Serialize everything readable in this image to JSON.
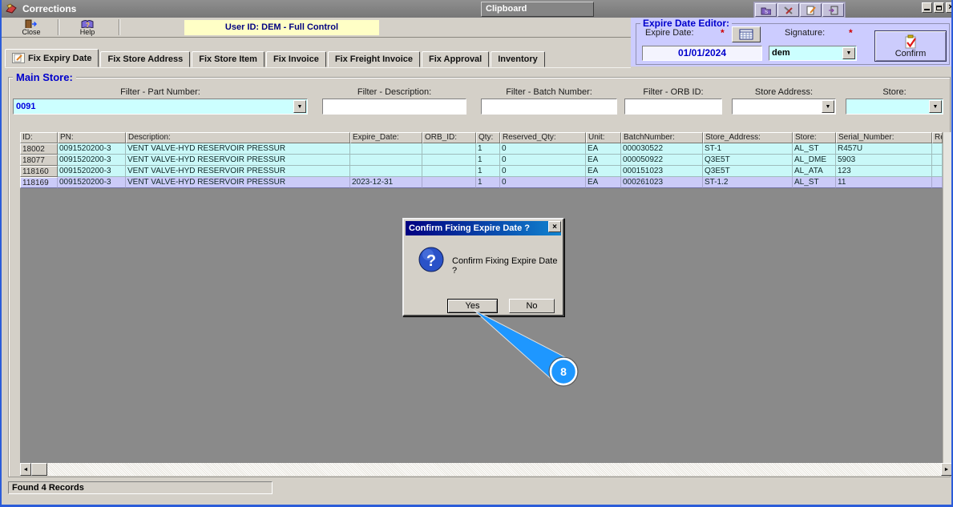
{
  "window": {
    "title": "Corrections",
    "secondary_title": "Clipboard"
  },
  "toolbar": {
    "close_label": "Close",
    "help_label": "Help",
    "user_banner": "User ID: DEM - Full Control"
  },
  "expire_editor": {
    "title": "Expire Date Editor:",
    "date_label": "Expire Date:",
    "required_marker": "*",
    "date_value": "01/01/2024",
    "signature_label": "Signature:",
    "signature_value": "dem",
    "confirm_label": "Confirm"
  },
  "tabs": [
    {
      "label": "Fix Expiry Date",
      "active": true
    },
    {
      "label": "Fix Store Address",
      "active": false
    },
    {
      "label": "Fix Store Item",
      "active": false
    },
    {
      "label": "Fix Invoice",
      "active": false
    },
    {
      "label": "Fix Freight Invoice",
      "active": false
    },
    {
      "label": "Fix Approval",
      "active": false
    },
    {
      "label": "Inventory",
      "active": false
    }
  ],
  "main_group": {
    "title": "Main Store:"
  },
  "filters": {
    "part_number": {
      "label": "Filter - Part Number:",
      "value": "0091"
    },
    "description": {
      "label": "Filter - Description:",
      "value": ""
    },
    "batch_number": {
      "label": "Filter - Batch Number:",
      "value": ""
    },
    "orb_id": {
      "label": "Filter - ORB ID:",
      "value": ""
    },
    "store_address": {
      "label": "Store Address:",
      "value": ""
    },
    "store": {
      "label": "Store:",
      "value": ""
    }
  },
  "grid": {
    "columns": [
      "ID:",
      "PN:",
      "Description:",
      "Expire_Date:",
      "ORB_ID:",
      "Qty:",
      "Reserved_Qty:",
      "Unit:",
      "BatchNumber:",
      "Store_Address:",
      "Store:",
      "Serial_Number:",
      "Re"
    ],
    "rows": [
      [
        "18002",
        "0091520200-3",
        "VENT VALVE-HYD RESERVOIR PRESSUR",
        "",
        "",
        "1",
        "0",
        "EA",
        "000030522",
        "ST-1",
        "AL_ST",
        "R457U",
        ""
      ],
      [
        "18077",
        "0091520200-3",
        "VENT VALVE-HYD RESERVOIR PRESSUR",
        "",
        "",
        "1",
        "0",
        "EA",
        "000050922",
        "Q3E5T",
        "AL_DME",
        "5903",
        ""
      ],
      [
        "118160",
        "0091520200-3",
        "VENT VALVE-HYD RESERVOIR PRESSUR",
        "",
        "",
        "1",
        "0",
        "EA",
        "000151023",
        "Q3E5T",
        "AL_ATA",
        "123",
        ""
      ],
      [
        "118169",
        "0091520200-3",
        "VENT VALVE-HYD RESERVOIR PRESSUR",
        "2023-12-31",
        "",
        "1",
        "0",
        "EA",
        "000261023",
        "ST-1.2",
        "AL_ST",
        "11",
        ""
      ]
    ],
    "selected_row_index": 3
  },
  "dialog": {
    "title": "Confirm Fixing Expire Date ?",
    "message": "Confirm Fixing Expire Date ?",
    "yes_label": "Yes",
    "no_label": "No"
  },
  "callout": {
    "number": "8"
  },
  "status_bar": {
    "text": "Found 4 Records"
  },
  "colors": {
    "cyan_field": "#ccffff",
    "lavender_panel": "#ccccff",
    "selected_row": "#cbcbf8",
    "banner_yellow": "#ffffc6",
    "group_title_blue": "#0000cc",
    "callout_blue": "#1e97ff",
    "dialog_title_gradient_start": "#000080",
    "dialog_title_gradient_end": "#1084d0"
  }
}
